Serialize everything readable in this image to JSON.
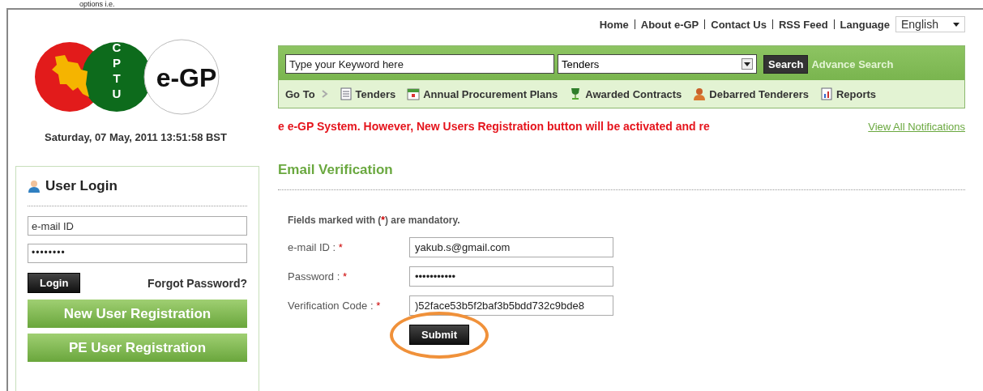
{
  "caption": "options i.e.",
  "logo": {
    "acronym": "CPTU",
    "name": "e-GP"
  },
  "datetime": "Saturday, 07 May, 2011 13:51:58 BST",
  "top_links": [
    "Home",
    "About e-GP",
    "Contact Us",
    "RSS Feed"
  ],
  "language": {
    "label": "Language",
    "value": "English"
  },
  "search": {
    "placeholder": "Type your Keyword here",
    "category": "Tenders",
    "button": "Search",
    "advanced": "Advance Search"
  },
  "goto": {
    "label": "Go To",
    "items": [
      {
        "label": "Tenders",
        "kind": "list"
      },
      {
        "label": "Annual Procurement Plans",
        "kind": "calendar"
      },
      {
        "label": "Awarded Contracts",
        "kind": "trophy"
      },
      {
        "label": "Debarred Tenderers",
        "kind": "person"
      },
      {
        "label": "Reports",
        "kind": "report"
      }
    ]
  },
  "notice": "e e-GP System. However, New Users Registration button will be activated and re",
  "view_all": "View All Notifications",
  "login": {
    "title": "User Login",
    "email_placeholder": "e-mail ID",
    "password": "••••••••",
    "login_button": "Login",
    "forgot": "Forgot Password?",
    "registration_buttons": [
      "New User Registration",
      "PE User Registration"
    ]
  },
  "verification": {
    "title": "Email Verification",
    "note": {
      "before": "Fields marked with (",
      "mark": "*",
      "after": ") are mandatory."
    },
    "fields": [
      {
        "label": "e-mail ID :",
        "required_mark": "*",
        "value": "yakub.s@gmail.com"
      },
      {
        "label": "Password :",
        "required_mark": "*",
        "value": "•••••••••••"
      },
      {
        "label": "Verification Code :",
        "required_mark": "*",
        "value": ")52face53b5f2baf3b5bdd732c9bde8"
      }
    ],
    "submit": "Submit",
    "submit_highlighted": true
  }
}
